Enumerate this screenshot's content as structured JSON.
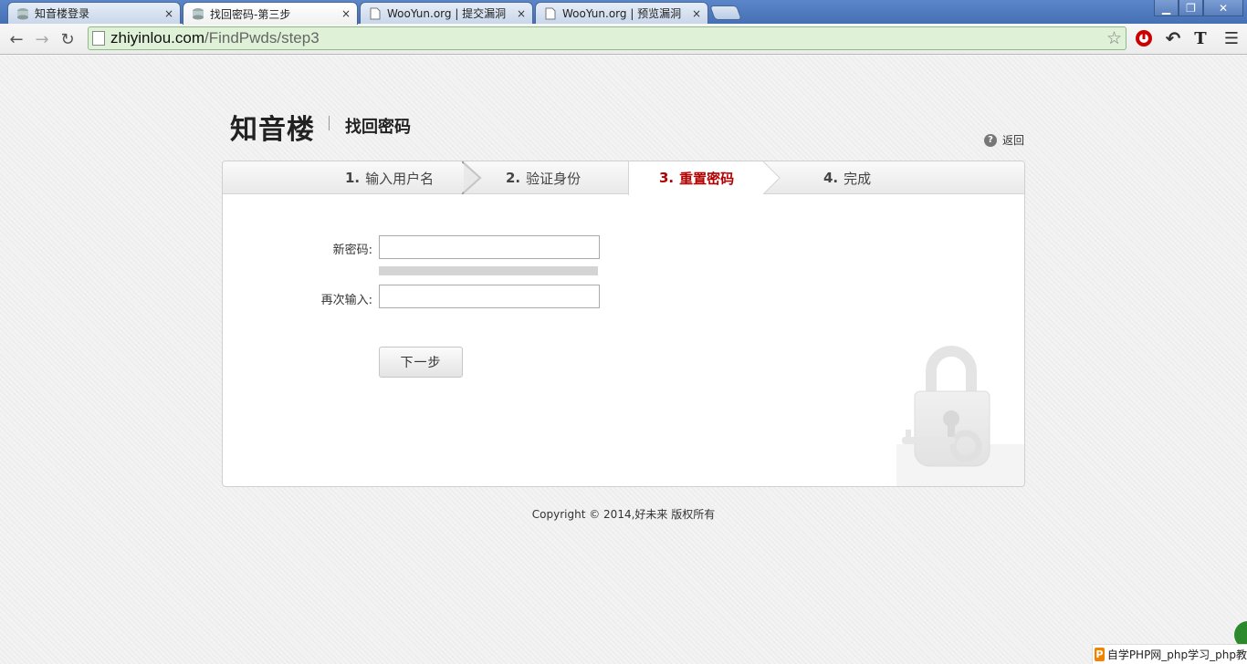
{
  "browser": {
    "tabs": [
      {
        "title": "知音楼登录",
        "active": false,
        "icon": "site-favicon"
      },
      {
        "title": "找回密码-第三步",
        "active": true,
        "icon": "site-favicon"
      },
      {
        "title": "WooYun.org | 提交漏洞",
        "active": false,
        "icon": "page-icon"
      },
      {
        "title": "WooYun.org | 预览漏洞",
        "active": false,
        "icon": "page-icon"
      }
    ],
    "close_glyph": "×",
    "url_domain": "zhiyinlou.com",
    "url_path": "/FindPwds/step3"
  },
  "header": {
    "logo_text": "知音楼",
    "subtitle": "找回密码",
    "back_label": "返回"
  },
  "steps": [
    {
      "num": "1.",
      "label": "输入用户名",
      "active": false
    },
    {
      "num": "2.",
      "label": "验证身份",
      "active": false
    },
    {
      "num": "3.",
      "label": "重置密码",
      "active": true
    },
    {
      "num": "4.",
      "label": "完成",
      "active": false
    }
  ],
  "form": {
    "new_password_label": "新密码:",
    "new_password_value": "",
    "confirm_label": "再次输入:",
    "confirm_value": "",
    "next_button": "下一步"
  },
  "footer": {
    "copyright": "Copyright © 2014,好未来 版权所有"
  },
  "corner_badge": {
    "icon_letter": "P",
    "text": "自学PHP网_php学习_php教"
  },
  "colors": {
    "active_step": "#b30000",
    "omnibox_bg": "#dff2d8",
    "tabstrip": "#4670b4"
  }
}
